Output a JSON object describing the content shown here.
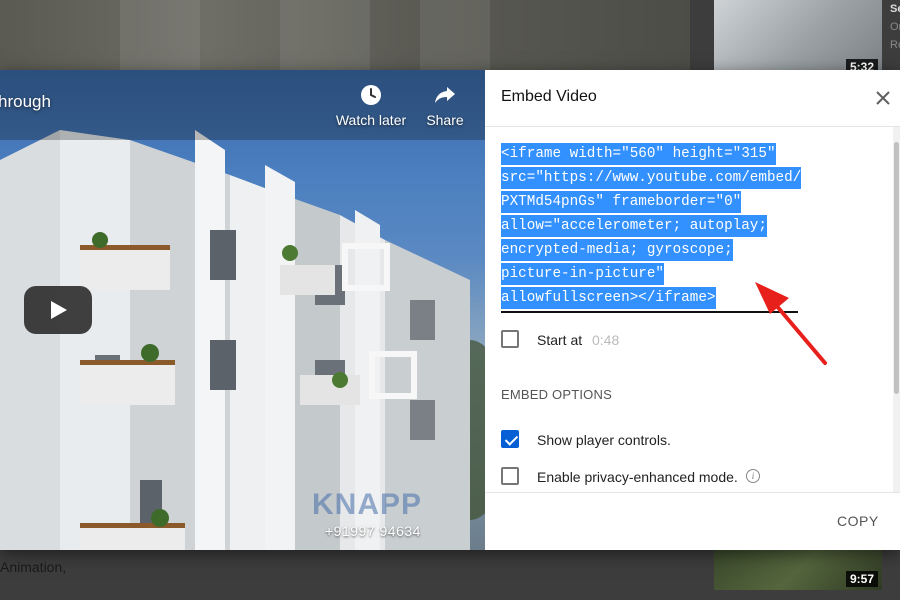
{
  "background": {
    "thumb_top_duration": "5:32",
    "thumb_bottom_duration": "9:57",
    "side_text_lines": [
      "Se",
      "Or",
      "Re"
    ],
    "lower_text": "Animation,"
  },
  "video": {
    "title_fragment": "hrough",
    "watch_later_label": "Watch later",
    "share_label": "Share",
    "watermark_text": "KNAPP",
    "phone_text": "+91997 94634"
  },
  "embed": {
    "title": "Embed Video",
    "code_lines": [
      "<iframe width=\"560\" height=\"315\"",
      "src=\"https://www.youtube.com/embed/",
      "PXTMd54pnGs\" frameborder=\"0\"",
      "allow=\"accelerometer; autoplay;",
      "encrypted-media; gyroscope;",
      "picture-in-picture\"",
      "allowfullscreen></iframe>"
    ],
    "start_at_label": "Start at",
    "start_at_time": "0:48",
    "start_at_checked": false,
    "options_heading": "EMBED OPTIONS",
    "show_controls_label": "Show player controls.",
    "show_controls_checked": true,
    "privacy_mode_label": "Enable privacy-enhanced mode.",
    "privacy_mode_checked": false,
    "copy_label": "COPY"
  },
  "colors": {
    "selection": "#3390ff",
    "checkbox_checked": "#065fd4",
    "annotation_arrow": "#e8201c"
  },
  "icons": [
    "clock-icon",
    "share-arrow-icon",
    "play-icon",
    "close-icon",
    "info-icon"
  ]
}
